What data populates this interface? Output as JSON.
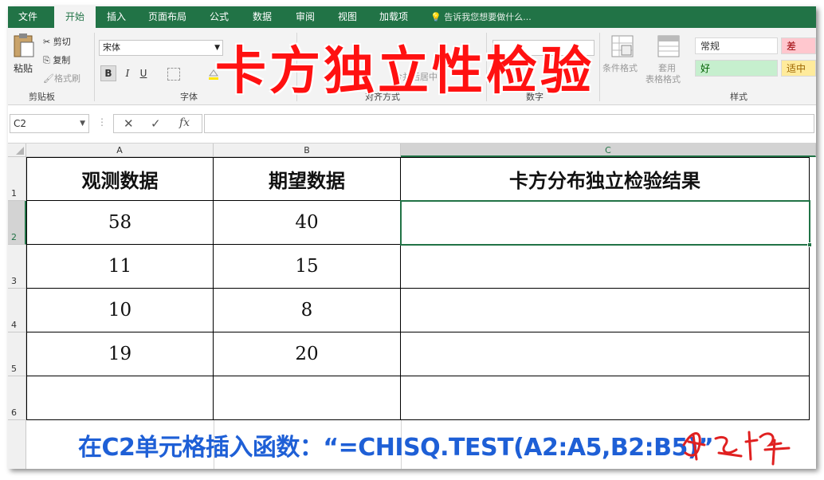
{
  "tabs": [
    "文件",
    "开始",
    "插入",
    "页面布局",
    "公式",
    "数据",
    "审阅",
    "视图",
    "加载项"
  ],
  "tell_me": "告诉我您想要做什么...",
  "ribbon": {
    "paste": "粘贴",
    "cut": "剪切",
    "copy": "复制",
    "format_painter": "格式刷",
    "clipboard_label": "剪贴板",
    "font_name": "宋体",
    "bold": "B",
    "italic": "I",
    "underline": "U",
    "font_label": "字体",
    "merge_center": "合并后居中",
    "align_label": "对齐方式",
    "number_label": "数字",
    "cond_format": "条件格式",
    "table_format_1": "套用",
    "table_format_2": "表格格式",
    "styles": [
      "常规",
      "差",
      "好",
      "适中"
    ],
    "styles_label": "样式"
  },
  "overlay_title": "卡方独立性检验",
  "formula_bar": {
    "name_box": "C2",
    "cancel": "✕",
    "enter": "✓",
    "fx": "fx",
    "content": ""
  },
  "columns": [
    "A",
    "B",
    "C"
  ],
  "rows": [
    "1",
    "2",
    "3",
    "4",
    "5",
    "6"
  ],
  "table": {
    "headers": [
      "观测数据",
      "期望数据",
      "卡方分布独立检验结果"
    ],
    "data": [
      [
        "58",
        "40",
        ""
      ],
      [
        "11",
        "15",
        ""
      ],
      [
        "10",
        "8",
        ""
      ],
      [
        "19",
        "20",
        ""
      ],
      [
        "",
        "",
        ""
      ]
    ]
  },
  "instruction": "在C2单元格插入函数：“=CHISQ.TEST(A2:A5,B2:B5)”",
  "colors": {
    "excel_green": "#217346",
    "title_red": "#ff1111",
    "note_blue": "#1e5fd6"
  }
}
